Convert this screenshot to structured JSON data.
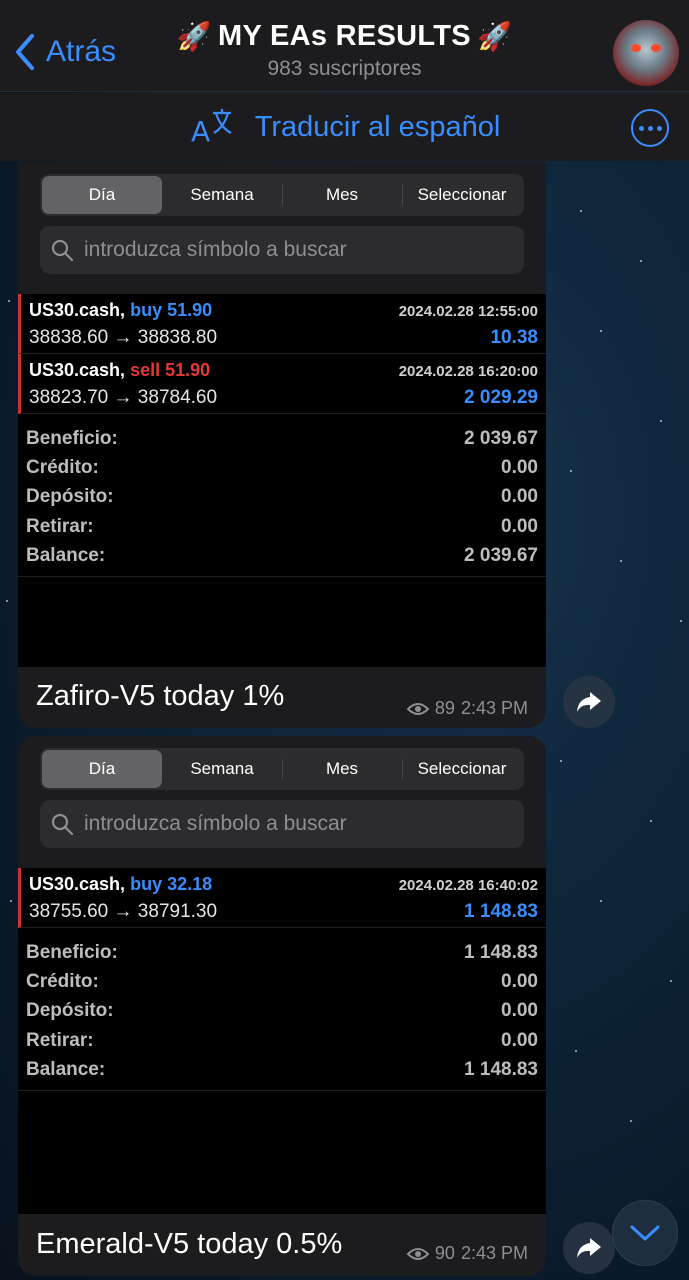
{
  "header": {
    "back_label": "Atrás",
    "channel_title": "MY EAs RESULTS",
    "title_emoji": "🚀",
    "subscribers": "983 suscriptores"
  },
  "translate": {
    "label": "Traducir al español"
  },
  "tabs": [
    "Día",
    "Semana",
    "Mes",
    "Seleccionar"
  ],
  "search_placeholder": "introduzca símbolo a buscar",
  "labels": {
    "profit": "Beneficio:",
    "credit": "Crédito:",
    "deposit": "Depósito:",
    "withdraw": "Retirar:",
    "balance": "Balance:"
  },
  "messages": [
    {
      "trades": [
        {
          "symbol": "US30.cash,",
          "side": "buy",
          "volume": "51.90",
          "time": "2024.02.28 12:55:00",
          "prices": "38838.60 → 38838.80",
          "profit": "10.38"
        },
        {
          "symbol": "US30.cash,",
          "side": "sell",
          "volume": "51.90",
          "time": "2024.02.28 16:20:00",
          "prices": "38823.70 → 38784.60",
          "profit": "2 029.29"
        }
      ],
      "summary": {
        "profit": "2 039.67",
        "credit": "0.00",
        "deposit": "0.00",
        "withdraw": "0.00",
        "balance": "2 039.67"
      },
      "caption": "Zafiro-V5 today 1%",
      "views": "89",
      "time": "2:43 PM"
    },
    {
      "trades": [
        {
          "symbol": "US30.cash,",
          "side": "buy",
          "volume": "32.18",
          "time": "2024.02.28 16:40:02",
          "prices": "38755.60 → 38791.30",
          "profit": "1 148.83"
        }
      ],
      "summary": {
        "profit": "1 148.83",
        "credit": "0.00",
        "deposit": "0.00",
        "withdraw": "0.00",
        "balance": "1 148.83"
      },
      "caption": "Emerald-V5 today 0.5%",
      "views": "90",
      "time": "2:43 PM"
    }
  ],
  "colors": {
    "accent": "#3a8dff",
    "sell": "#e53935",
    "bubble": "#1c1c1e"
  }
}
